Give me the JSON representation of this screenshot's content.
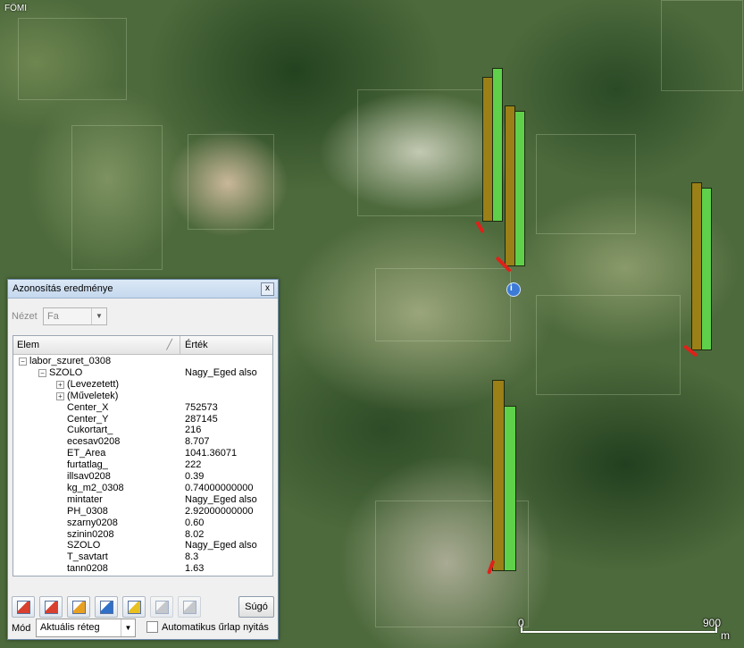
{
  "map": {
    "copyright": "FÖMI",
    "scale": {
      "start": "0",
      "end": "900",
      "unit": "m"
    }
  },
  "dialog": {
    "title": "Azonosítás eredménye",
    "close_symbol": "x",
    "view_label": "Nézet",
    "view_value": "Fa",
    "columns": {
      "elem": "Elem",
      "value": "Érték"
    },
    "tree": {
      "layer": "labor_szuret_0308",
      "feature": {
        "name": "SZOLO",
        "value": "Nagy_Eged also"
      },
      "derived": "(Levezetett)",
      "actions": "(Műveletek)",
      "attributes": [
        {
          "name": "Center_X",
          "value": "752573"
        },
        {
          "name": "Center_Y",
          "value": "287145"
        },
        {
          "name": "Cukortart_",
          "value": "216"
        },
        {
          "name": "ecesav0208",
          "value": "8.707"
        },
        {
          "name": "ET_Area",
          "value": "1041.36071"
        },
        {
          "name": "furtatlag_",
          "value": "222"
        },
        {
          "name": "illsav0208",
          "value": "0.39"
        },
        {
          "name": "kg_m2_0308",
          "value": "0.74000000000"
        },
        {
          "name": "mintater",
          "value": "Nagy_Eged also"
        },
        {
          "name": "PH_0308",
          "value": "2.92000000000"
        },
        {
          "name": "szarny0208",
          "value": "0.60"
        },
        {
          "name": "szinin0208",
          "value": "8.02"
        },
        {
          "name": "SZOLO",
          "value": "Nagy_Eged also"
        },
        {
          "name": "T_savtart",
          "value": "8.3"
        },
        {
          "name": "tann0208",
          "value": "1.63"
        }
      ]
    },
    "toolbar": {
      "help_label": "Súgó",
      "icons": [
        "expand-tree-icon",
        "collapse-tree-icon",
        "expand-new-icon",
        "view-features-icon",
        "deselect-icon",
        "copy-icon",
        "print-icon"
      ]
    },
    "mode_label": "Mód",
    "mode_value": "Aktuális réteg",
    "auto_form_label": "Automatikus űrlap nyitás",
    "auto_form_checked": false
  },
  "colors": {
    "bar_olive": "#9b7f17",
    "bar_green": "#5fd04a",
    "marker_red": "#e0201a"
  }
}
